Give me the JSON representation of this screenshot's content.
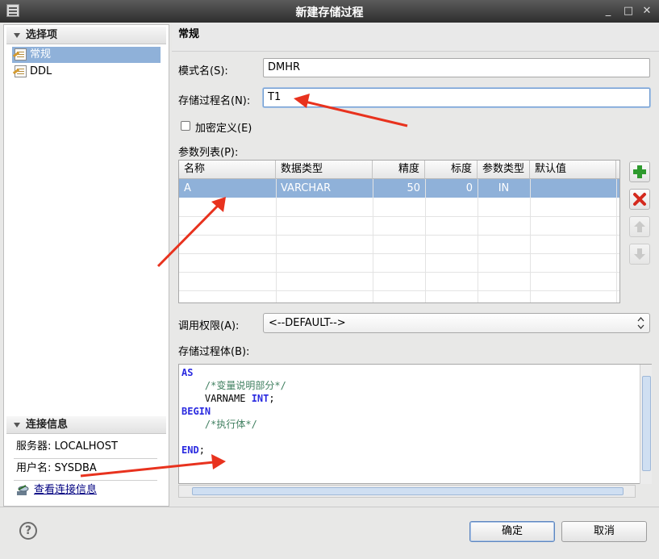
{
  "window": {
    "title": "新建存储过程",
    "minimize": "_",
    "maximize": "□",
    "close": "✕"
  },
  "left_panel": {
    "section_title": "选择项",
    "items": [
      {
        "label": "常规",
        "selected": true
      },
      {
        "label": "DDL",
        "selected": false
      }
    ],
    "conn_section_title": "连接信息",
    "server": "服务器: LOCALHOST",
    "user": "用户名: SYSDBA",
    "view_conn_link": "查看连接信息"
  },
  "general": {
    "header": "常规",
    "schema_label": "模式名(S):",
    "schema_value": "DMHR",
    "proc_label": "存储过程名(N):",
    "proc_value": "T1",
    "encrypt_label": "加密定义(E)",
    "params_label": "参数列表(P):",
    "columns": [
      "名称",
      "数据类型",
      "精度",
      "标度",
      "参数类型",
      "默认值"
    ],
    "rows": [
      {
        "name": "A",
        "type": "VARCHAR",
        "precision": "50",
        "scale": "0",
        "mode": "IN",
        "default": ""
      }
    ],
    "auth_label": "调用权限(A):",
    "auth_value": "<--DEFAULT-->",
    "body_label": "存储过程体(B):",
    "code": {
      "l1": "AS",
      "l2": "/*变量说明部分*/",
      "l3a": "VARNAME ",
      "l3b": "INT",
      "l3c": ";",
      "l4": "BEGIN",
      "l5": "/*执行体*/",
      "l6a": "END",
      "l6b": ";"
    }
  },
  "buttons": {
    "ok": "确定",
    "cancel": "取消",
    "help": "?"
  },
  "colors": {
    "selection": "#8fb1d9",
    "keyword": "#2a2ae0",
    "comment": "#3f7f5f",
    "arrow": "#e8321e"
  }
}
